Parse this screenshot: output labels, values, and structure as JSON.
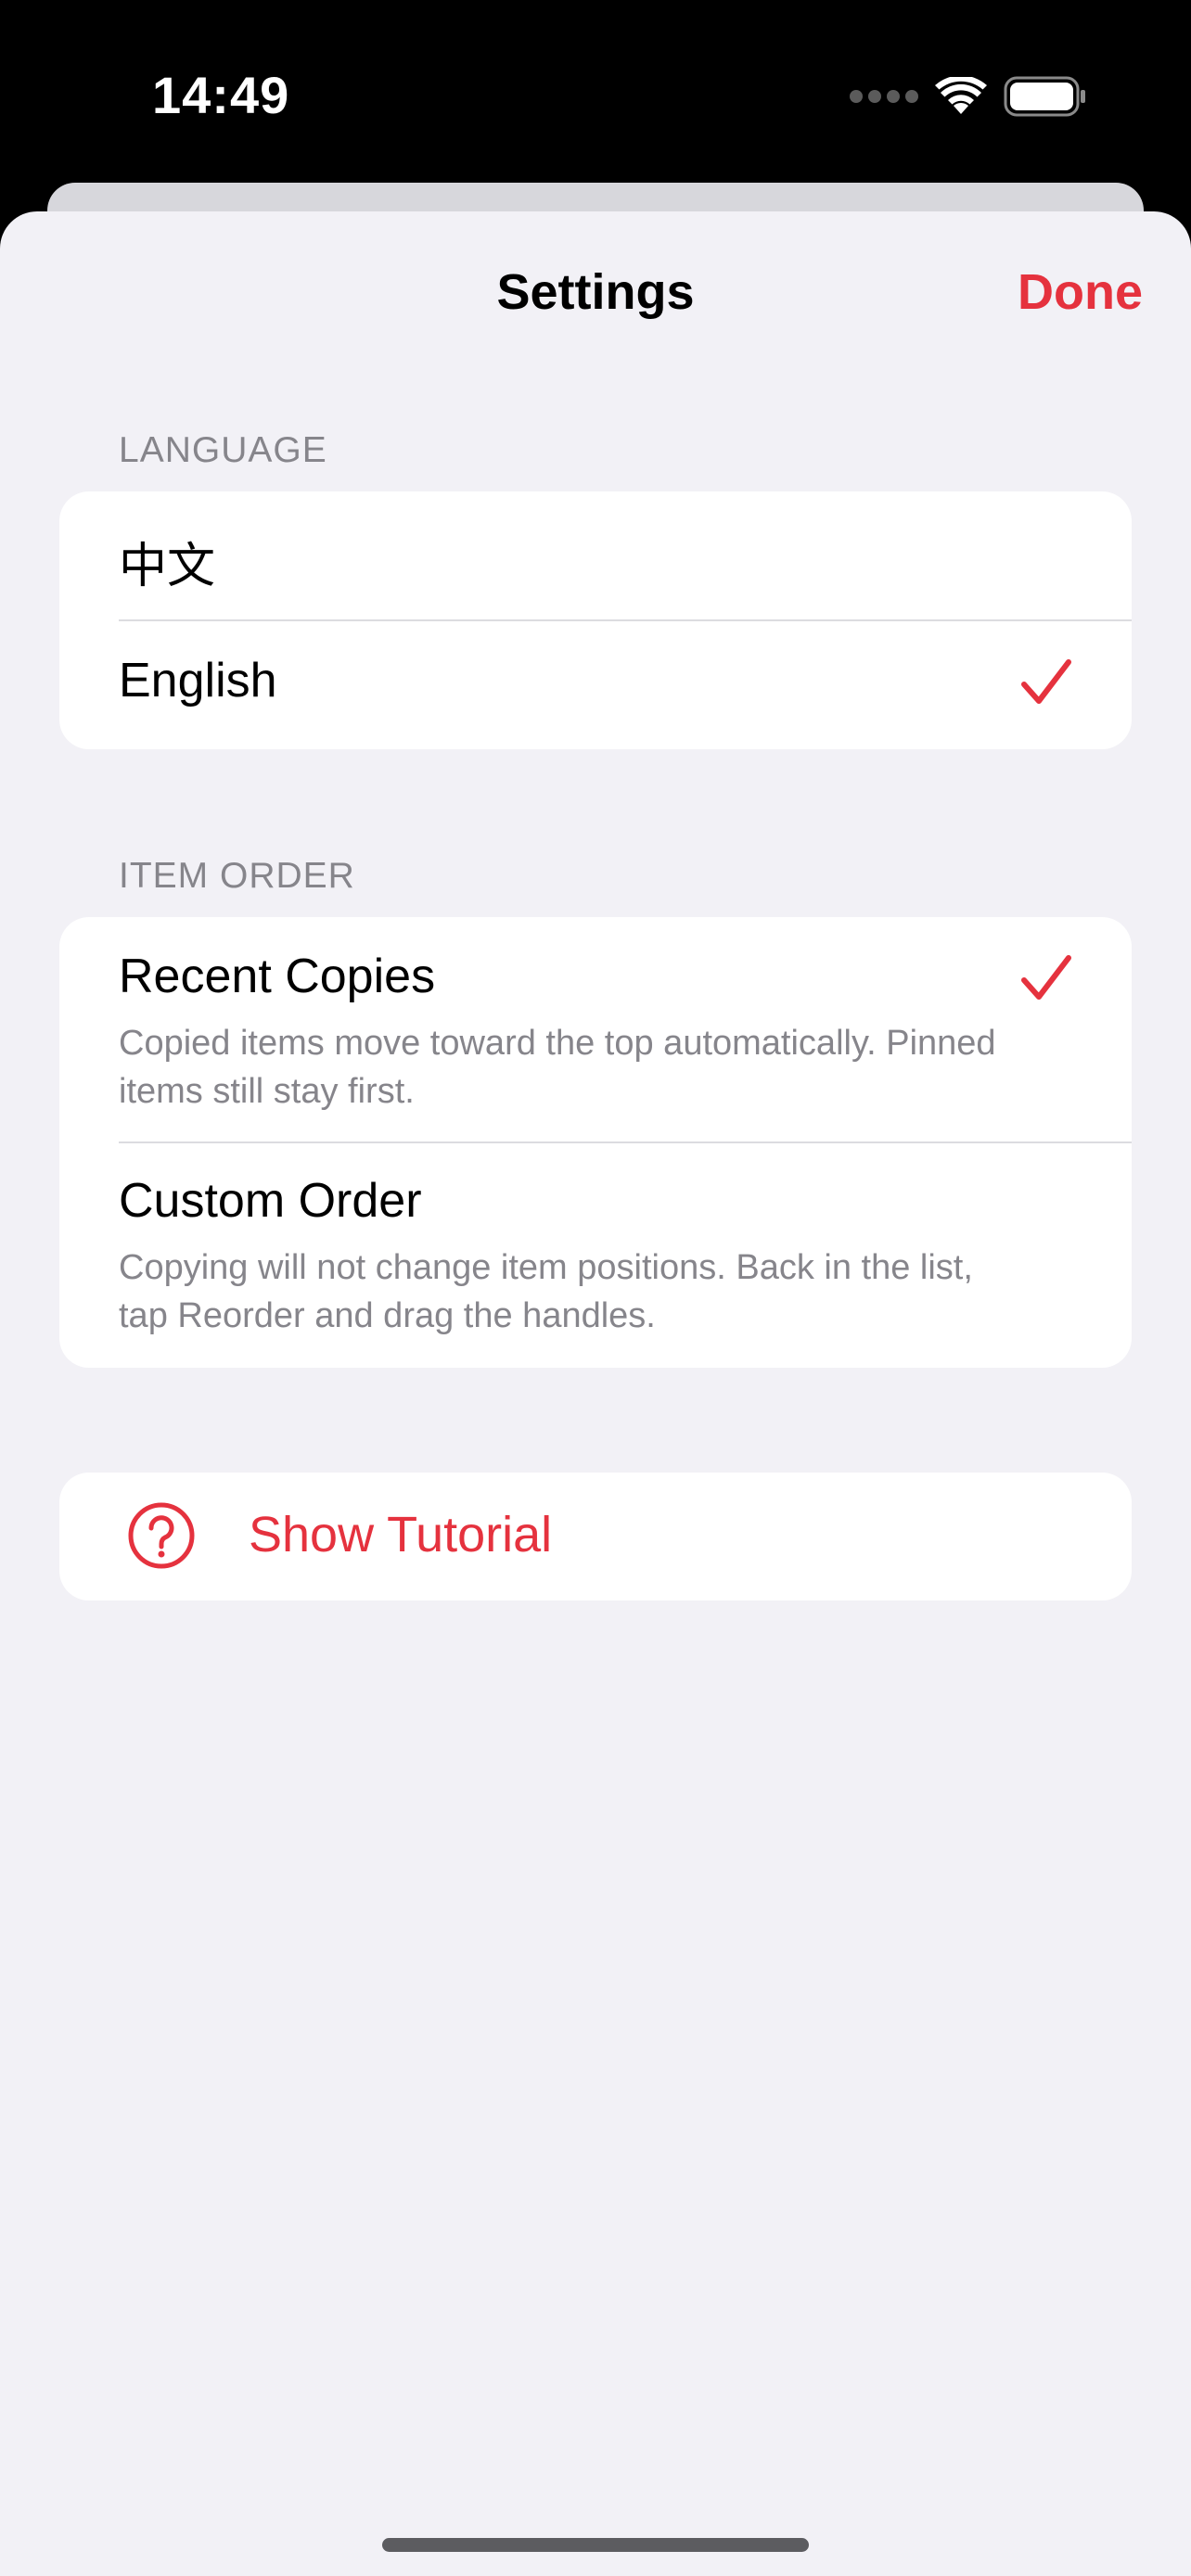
{
  "status_bar": {
    "time": "14:49"
  },
  "nav": {
    "title": "Settings",
    "done_label": "Done"
  },
  "language": {
    "header": "LANGUAGE",
    "options": [
      {
        "label": "中文",
        "selected": false
      },
      {
        "label": "English",
        "selected": true
      }
    ]
  },
  "item_order": {
    "header": "ITEM ORDER",
    "options": [
      {
        "label": "Recent Copies",
        "description": "Copied items move toward the top automatically. Pinned items still stay first.",
        "selected": true
      },
      {
        "label": "Custom Order",
        "description": "Copying will not change item positions. Back in the list, tap Reorder and drag the handles.",
        "selected": false
      }
    ]
  },
  "tutorial": {
    "label": "Show Tutorial",
    "icon": "question-circle-icon"
  },
  "colors": {
    "accent": "#e5323e",
    "background": "#f2f1f6",
    "secondary_text": "#86858b"
  }
}
